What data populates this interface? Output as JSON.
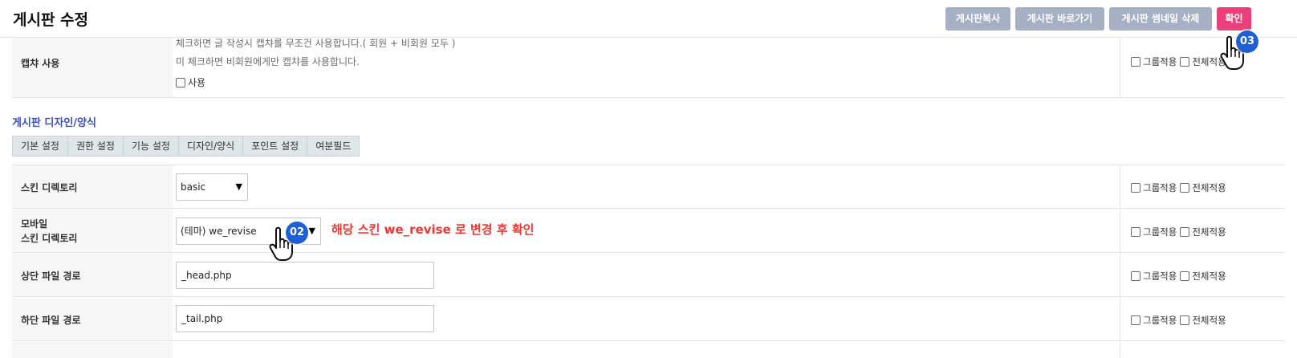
{
  "header": {
    "title": "게시판 수정",
    "buttons": {
      "copy": "게시판복사",
      "goto": "게시판 바로가기",
      "delete_thumbnail": "게시판 썸네일 삭제",
      "confirm": "확인"
    }
  },
  "captcha_row": {
    "label": "캡챠 사용",
    "help_line1": "체크하면 글 작성시 캡챠를 무조건 사용합니다.( 회원 + 비회원 모두 )",
    "help_line2": "미 체크하면 비회원에게만 캡챠를 사용합니다.",
    "checkbox_label": "사용"
  },
  "section": {
    "title": "게시판 디자인/양식",
    "tabs": [
      "기본 설정",
      "권한 설정",
      "기능 설정",
      "디자인/양식",
      "포인트 설정",
      "여분필드"
    ]
  },
  "rows": {
    "skin_dir": {
      "label": "스킨 디렉토리",
      "value": "basic"
    },
    "mobile_skin_dir": {
      "label_line1": "모바일",
      "label_line2": "스킨 디렉토리",
      "value": "(테마) we_revise"
    },
    "head_file": {
      "label": "상단 파일 경로",
      "value": "_head.php"
    },
    "tail_file": {
      "label": "하단 파일 경로",
      "value": "_tail.php"
    }
  },
  "options": {
    "group_apply": "그룹적용",
    "all_apply": "전체적용"
  },
  "annotation": {
    "text": "해당 스킨 we_revise 로 변경 후 확인"
  },
  "badges": {
    "step2": "02",
    "step3": "03"
  },
  "colors": {
    "accent_pink": "#ec407a",
    "button_gray": "#a5b0c4",
    "badge_blue": "#1f5fd6",
    "annotation_red": "#e53935",
    "section_title_blue": "#3f51b5"
  }
}
